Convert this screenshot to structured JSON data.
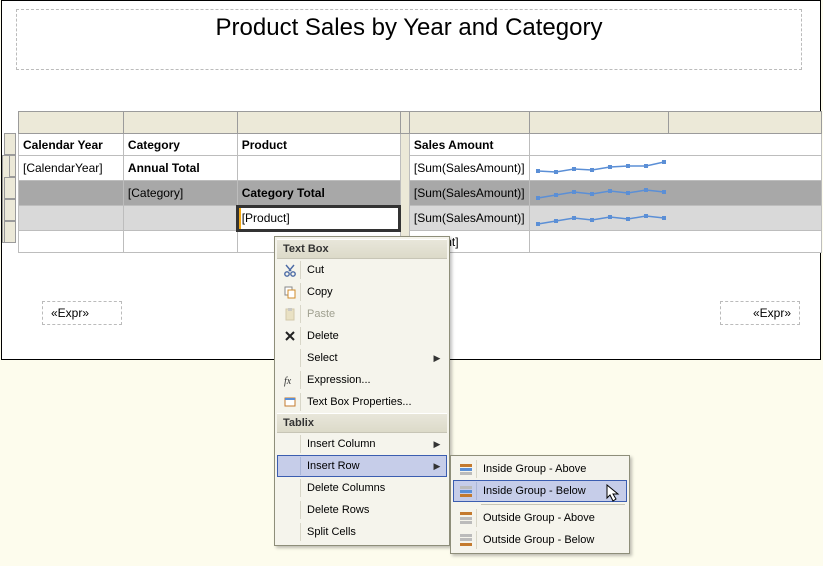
{
  "title": "Product Sales by Year and Category",
  "columns": {
    "year": "Calendar Year",
    "category": "Category",
    "product": "Product",
    "amount": "Sales Amount"
  },
  "rows": {
    "r1": {
      "year": "[CalendarYear]",
      "category": "Annual Total",
      "product": "",
      "amount": "[Sum(SalesAmount)]"
    },
    "r2": {
      "year": "",
      "category": "[Category]",
      "product": "Category Total",
      "amount": "[Sum(SalesAmount)]"
    },
    "r3": {
      "year": "",
      "category": "",
      "product": "[Product]",
      "amount": "[Sum(SalesAmount)]"
    },
    "r4": {
      "year": "",
      "category": "",
      "product": "",
      "amount": "Amount]"
    }
  },
  "footer": {
    "expr_left": "«Expr»",
    "expr_right": "«Expr»"
  },
  "menu": {
    "section1": "Text Box",
    "cut": "Cut",
    "copy": "Copy",
    "paste": "Paste",
    "delete": "Delete",
    "select": "Select",
    "expression": "Expression...",
    "textboxprops": "Text Box Properties...",
    "section2": "Tablix",
    "insertcol": "Insert Column",
    "insertrow": "Insert Row",
    "delcols": "Delete Columns",
    "delrows": "Delete Rows",
    "splitcells": "Split Cells"
  },
  "submenu": {
    "ig_above": "Inside Group - Above",
    "ig_below": "Inside Group - Below",
    "og_above": "Outside Group - Above",
    "og_below": "Outside Group - Below"
  },
  "chart_data": [
    {
      "type": "line",
      "series": [
        {
          "name": "s1",
          "values": [
            58,
            56,
            62,
            60,
            64,
            66,
            65,
            72
          ]
        }
      ],
      "ylim": [
        40,
        80
      ]
    },
    {
      "type": "line",
      "series": [
        {
          "name": "s1",
          "values": [
            50,
            55,
            60,
            57,
            62,
            59,
            63,
            60
          ]
        }
      ],
      "ylim": [
        40,
        80
      ]
    },
    {
      "type": "line",
      "series": [
        {
          "name": "s1",
          "values": [
            48,
            52,
            56,
            54,
            58,
            55,
            60,
            57
          ]
        }
      ],
      "ylim": [
        40,
        80
      ]
    }
  ]
}
